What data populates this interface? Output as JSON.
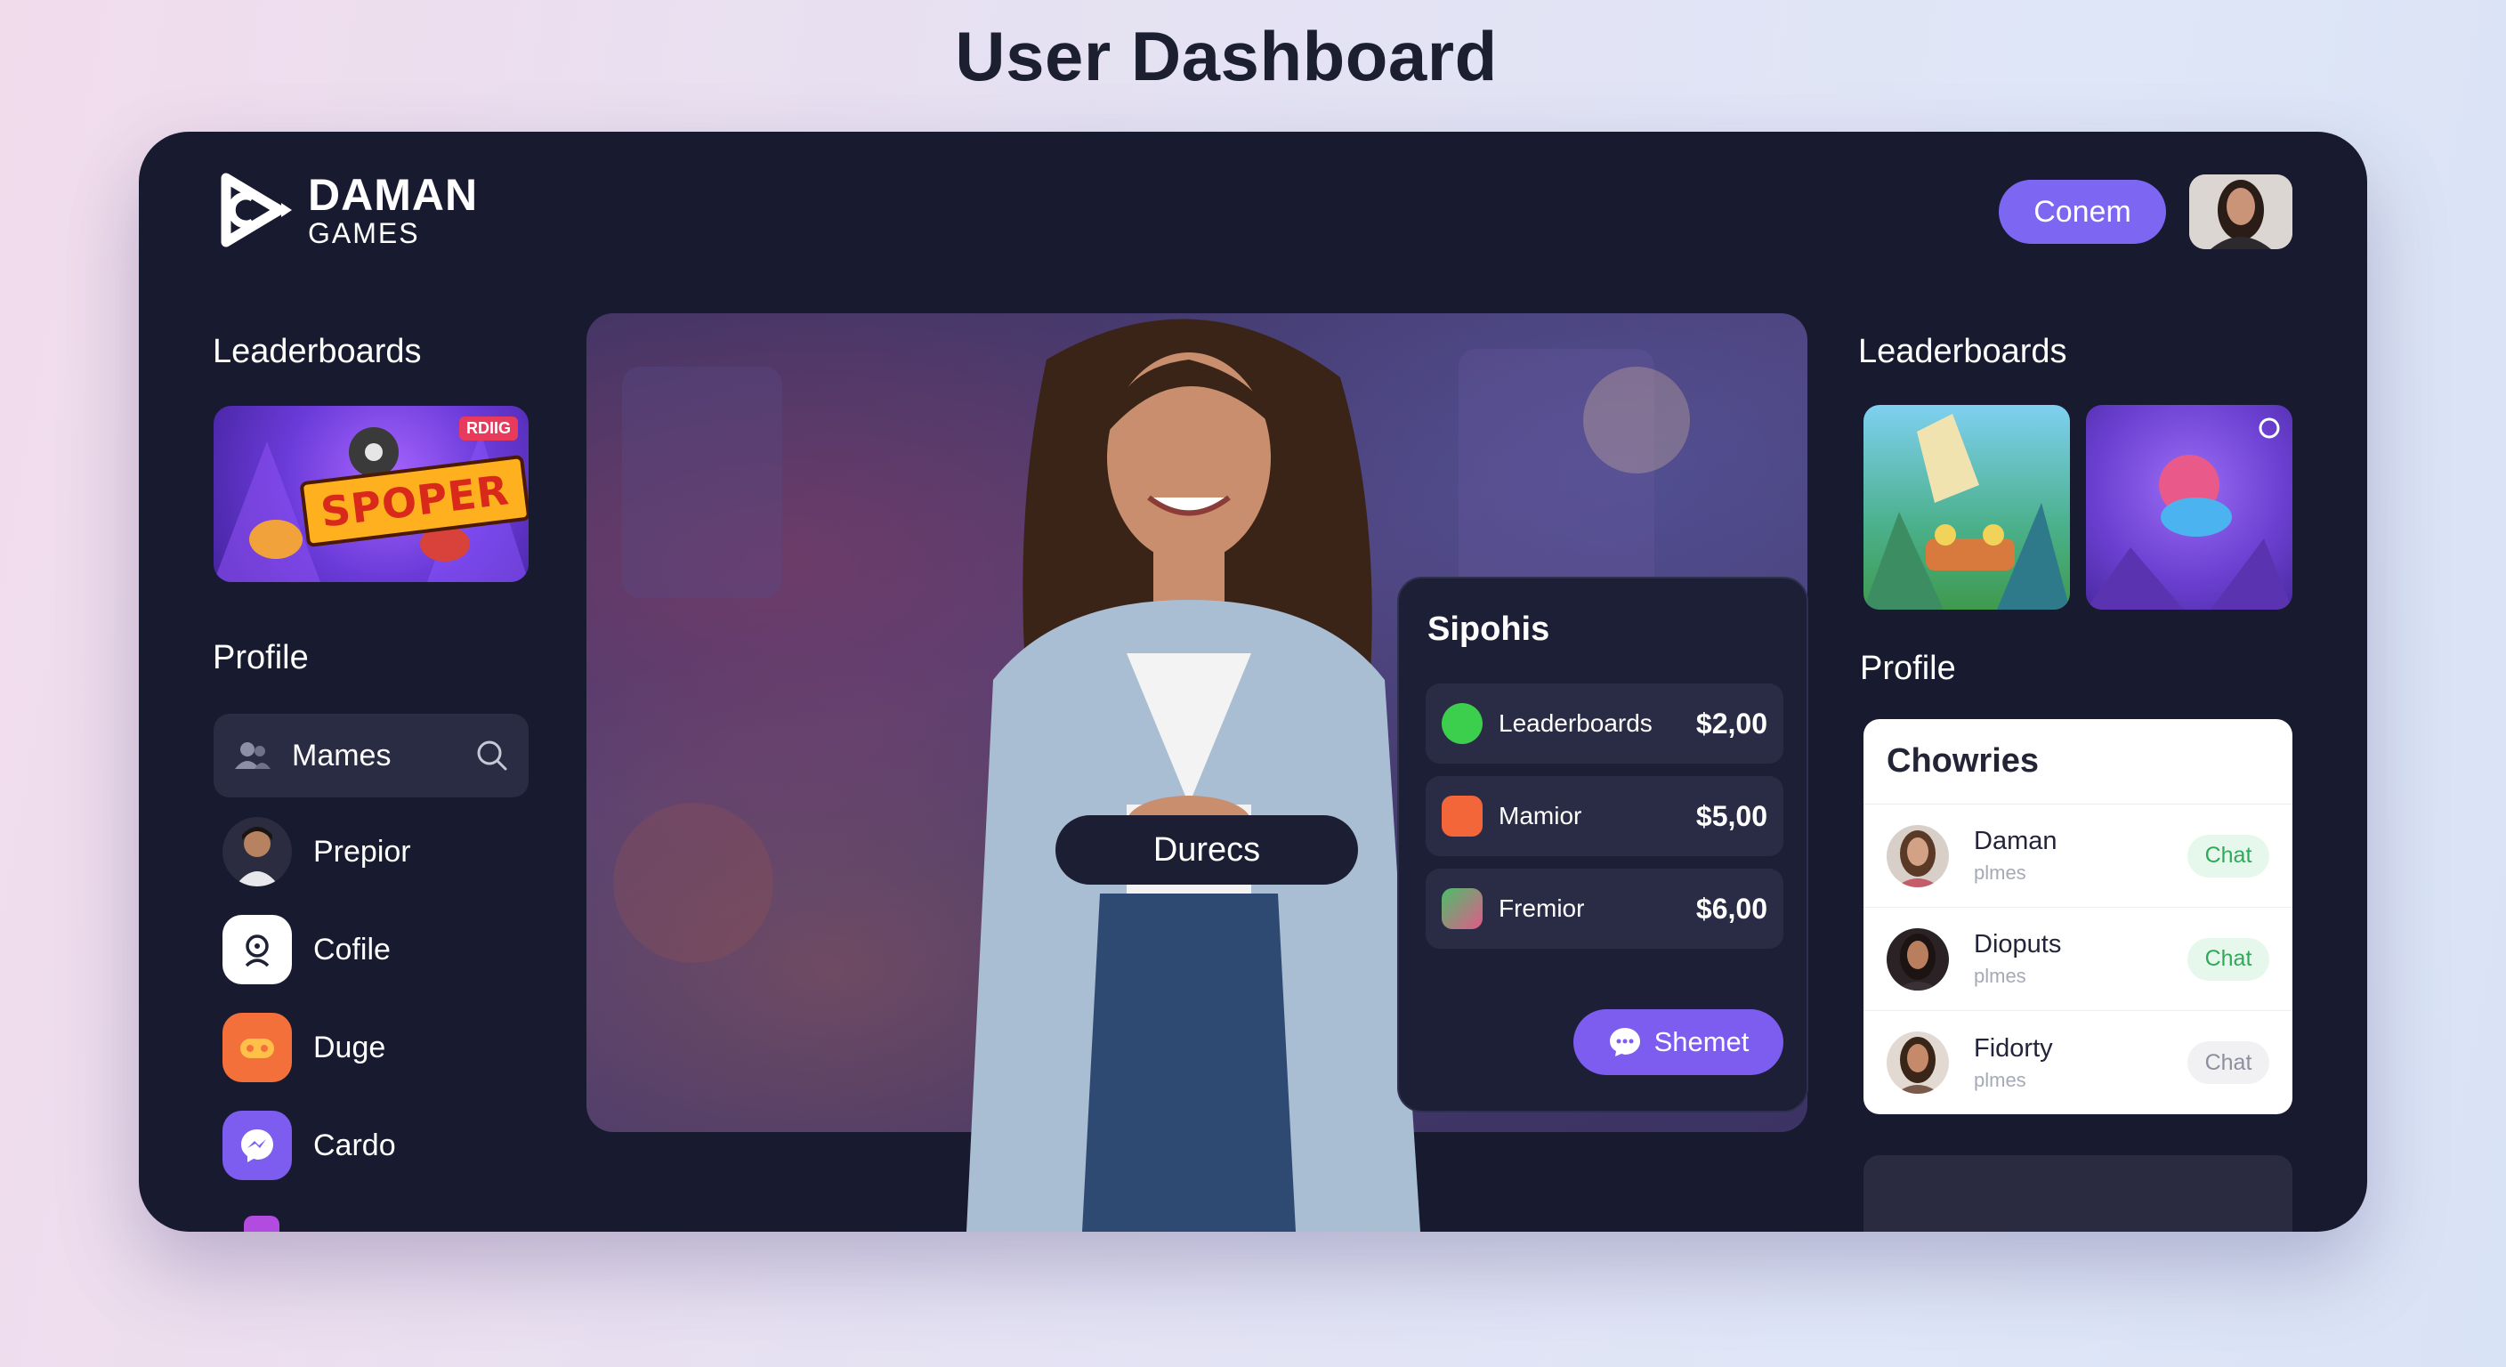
{
  "page_title": "User Dashboard",
  "brand": {
    "name": "DAMAN",
    "sub": "GAMES"
  },
  "header": {
    "connect_label": "Conem"
  },
  "left": {
    "leaderboards_title": "Leaderboards",
    "thumb_banner": "SPOPER",
    "thumb_badge": "RDIIG",
    "profile_title": "Profile",
    "search_label": "Mames",
    "menu": [
      {
        "label": "Prepior",
        "icon": "avatar-icon"
      },
      {
        "label": "Cofile",
        "icon": "profile-icon"
      },
      {
        "label": "Duge",
        "icon": "gamepad-icon"
      },
      {
        "label": "Cardo",
        "icon": "messenger-icon"
      }
    ]
  },
  "hero": {
    "pill_label": "Durecs"
  },
  "popup": {
    "title": "Sipohis",
    "rows": [
      {
        "label": "Leaderboards",
        "value": "$2,00",
        "icon_color": "#3ccf4e"
      },
      {
        "label": "Mamior",
        "value": "$5,00",
        "icon_color": "#f2663a"
      },
      {
        "label": "Fremior",
        "value": "$6,00",
        "icon_color": "#4bbf6a"
      }
    ],
    "share_label": "Shemet"
  },
  "right": {
    "leaderboards_title": "Leaderboards",
    "profile_title": "Profile",
    "chat_title": "Chowries",
    "chats": [
      {
        "name": "Daman",
        "sub": "plmes",
        "button": "Chat",
        "btn_bg": "#e6f7ec",
        "btn_color": "#2fa95a"
      },
      {
        "name": "Dioputs",
        "sub": "plmes",
        "button": "Chat",
        "btn_bg": "#e6f7ec",
        "btn_color": "#2fa95a"
      },
      {
        "name": "Fidorty",
        "sub": "plmes",
        "button": "Chat",
        "btn_bg": "#f1f1f4",
        "btn_color": "#8c8f9c"
      }
    ]
  },
  "colors": {
    "accent": "#7d66f2",
    "frame": "#181a2f",
    "panel": "#2a2c45"
  }
}
